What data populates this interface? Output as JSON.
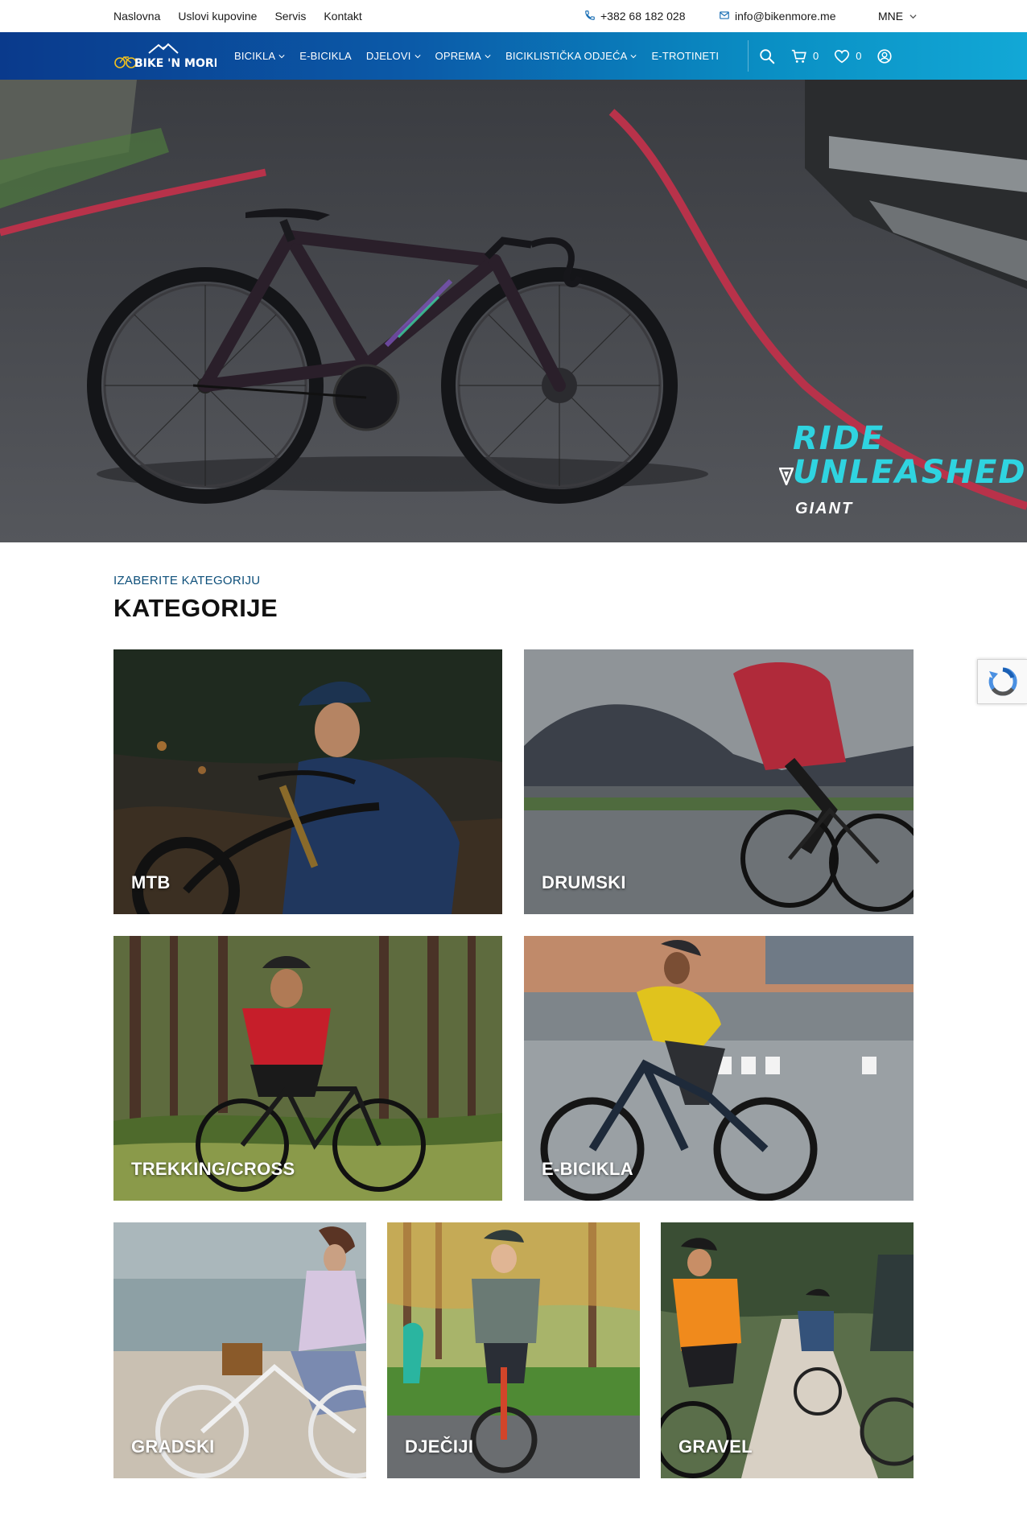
{
  "topbar": {
    "links": [
      "Naslovna",
      "Uslovi kupovine",
      "Servis",
      "Kontakt"
    ],
    "phone": "+382 68 182 028",
    "email": "info@bikenmore.me",
    "language": "MNE"
  },
  "nav": {
    "logo_text": "BIKE 'N MORE",
    "items": [
      {
        "label": "BICIKLA",
        "has_dropdown": true
      },
      {
        "label": "E-BICIKLA",
        "has_dropdown": false
      },
      {
        "label": "DJELOVI",
        "has_dropdown": true
      },
      {
        "label": "OPREMA",
        "has_dropdown": true
      },
      {
        "label": "BICIKLISTIČKA ODJEĆA",
        "has_dropdown": true
      },
      {
        "label": "E-TROTINETI",
        "has_dropdown": false
      }
    ],
    "cart_count": "0",
    "wishlist_count": "0"
  },
  "hero": {
    "headline_line1": "RIDE",
    "headline_line2": "UNLEASHED",
    "brand": "GIANT",
    "slide_count": 5,
    "active_slide": 2
  },
  "categories": {
    "kicker": "IZABERITE KATEGORIJU",
    "title": "KATEGORIJE",
    "items": [
      "MTB",
      "DRUMSKI",
      "TREKKING/CROSS",
      "E-BICIKLA",
      "GRADSKI",
      "DJEČIJI",
      "GRAVEL"
    ]
  },
  "colors": {
    "nav_gradient_start": "#0a3a8c",
    "nav_gradient_end": "#12a8d6",
    "hero_accent": "#2fd4e0",
    "kicker": "#0d4f7a"
  }
}
